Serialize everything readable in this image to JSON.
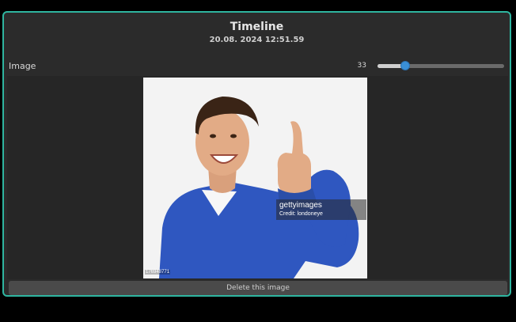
{
  "window": {
    "title": "Timeline",
    "timestamp": "20.08. 2024 12:51.59",
    "border_color": "#2fb5a0"
  },
  "image_row": {
    "label": "Image",
    "slider": {
      "value": "33",
      "fraction": 0.22,
      "handle_color": "#3a8fd6"
    }
  },
  "photo": {
    "watermark_brand": "gettyimages",
    "watermark_credit": "Credit: londoneye",
    "photo_id": "176948771"
  },
  "actions": {
    "delete_label": "Delete this image"
  }
}
